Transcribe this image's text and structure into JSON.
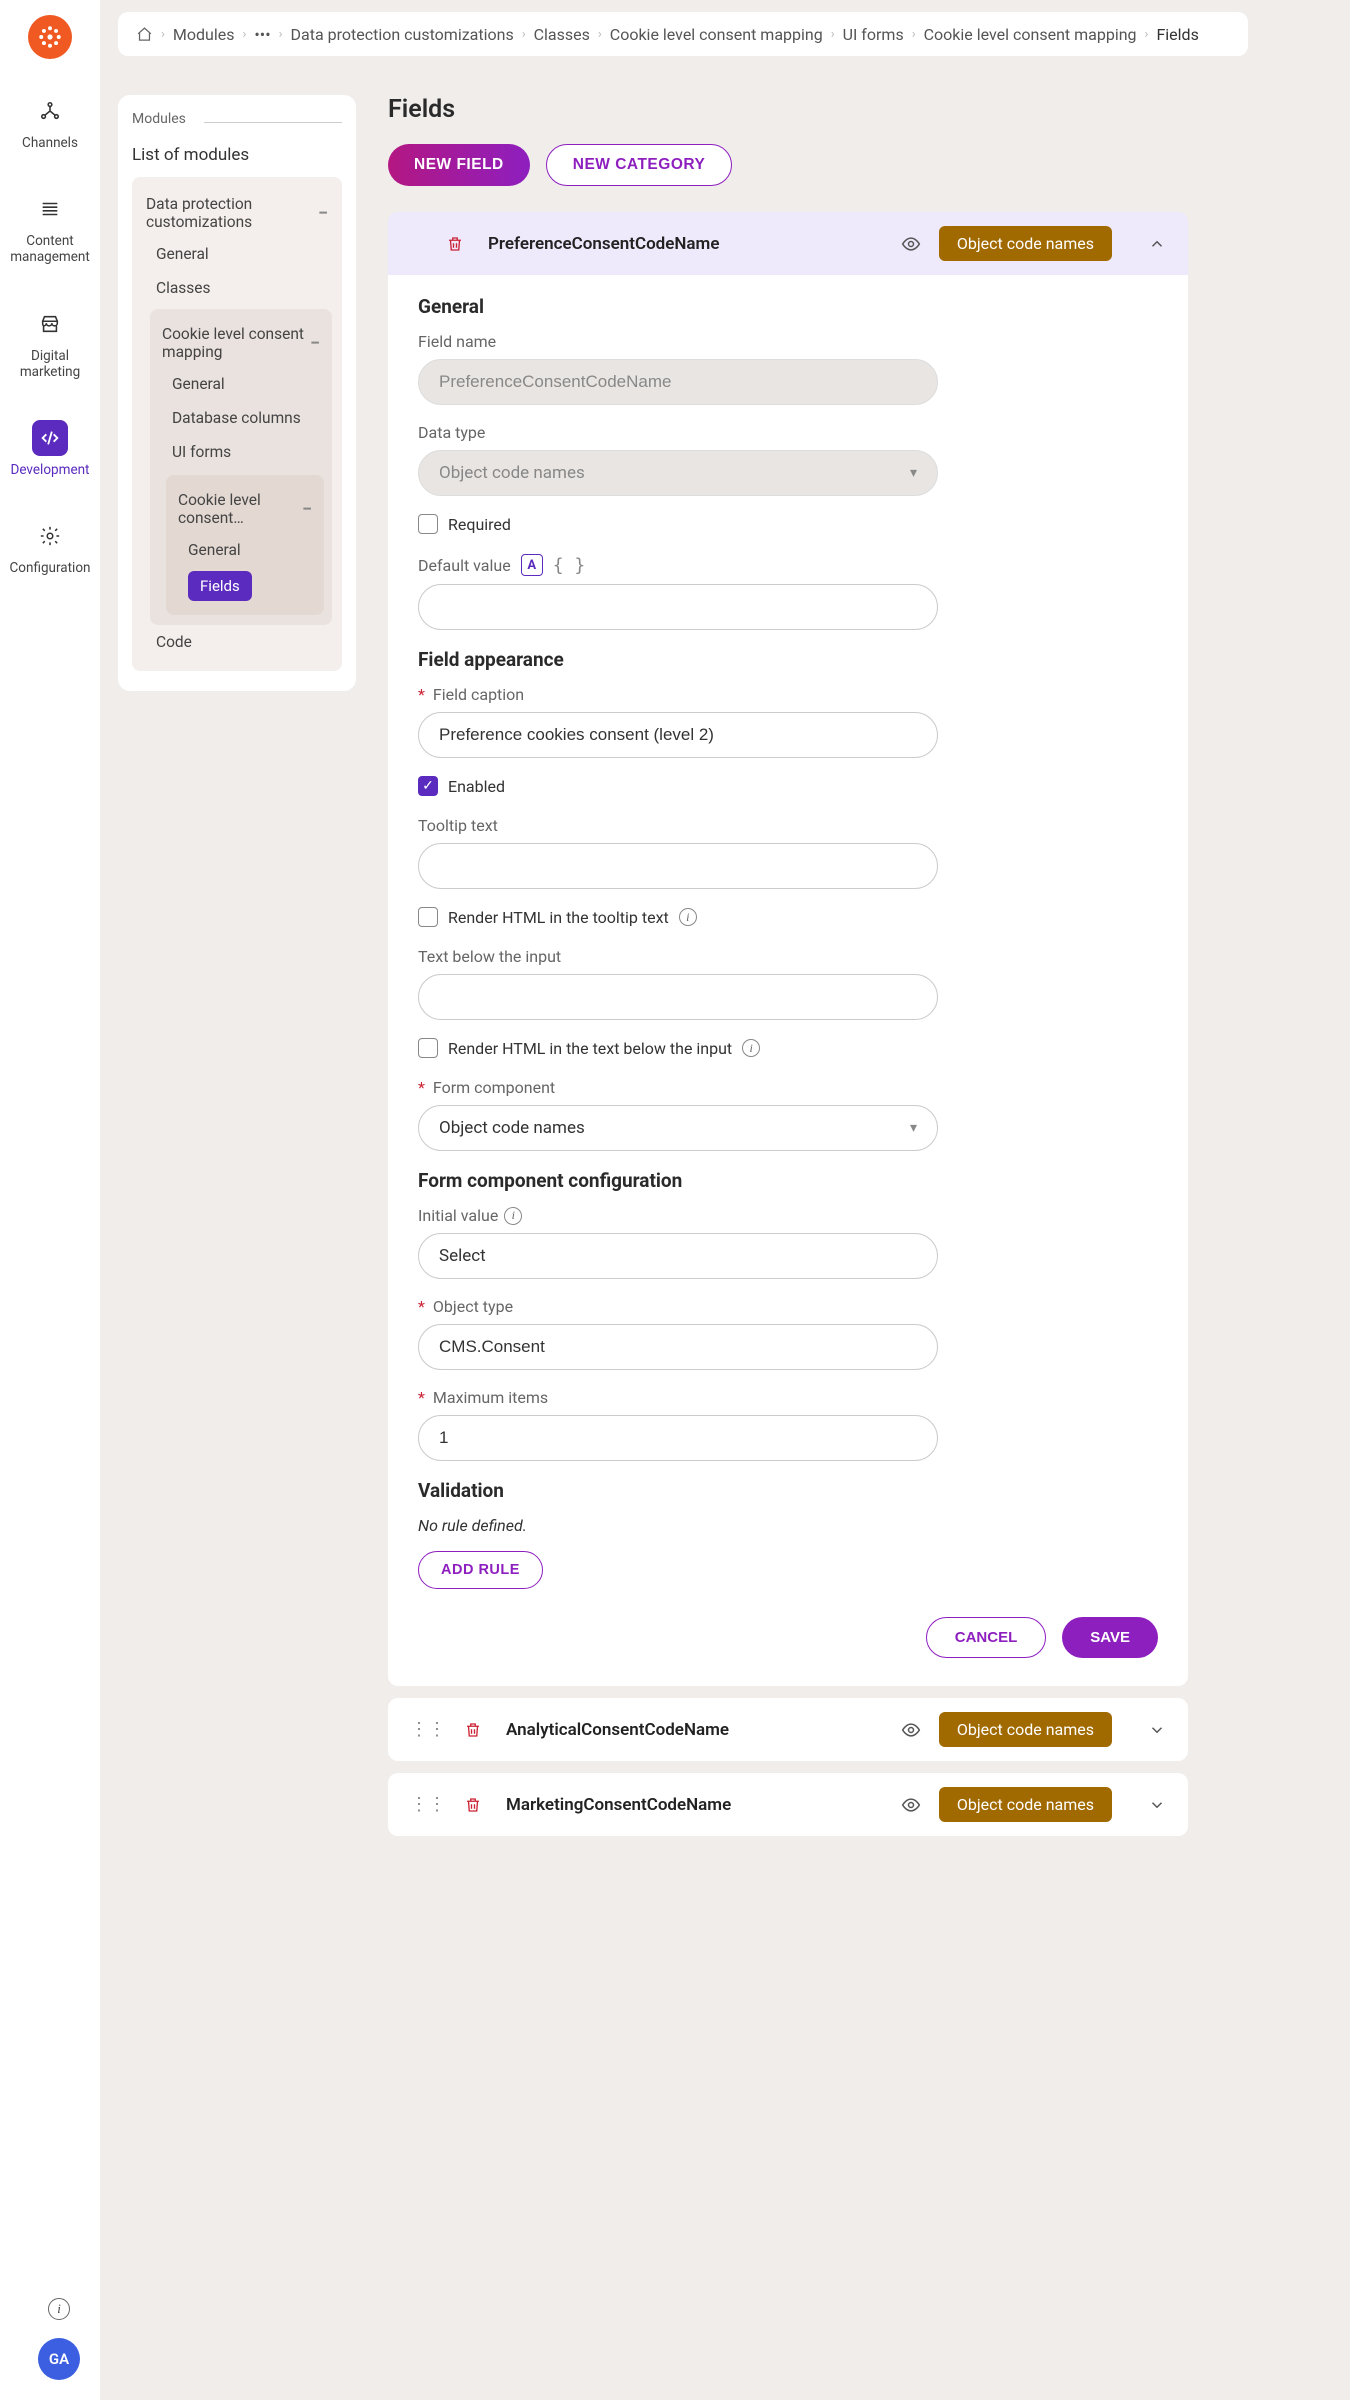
{
  "rail": {
    "items": [
      {
        "label": "Channels"
      },
      {
        "label": "Content management"
      },
      {
        "label": "Digital marketing"
      },
      {
        "label": "Development"
      },
      {
        "label": "Configuration"
      }
    ]
  },
  "breadcrumbs": [
    "Modules",
    "•••",
    "Data protection customizations",
    "Classes",
    "Cookie level consent mapping",
    "UI forms",
    "Cookie level consent mapping",
    "Fields"
  ],
  "midPanel": {
    "head": "Modules",
    "title": "List of modules",
    "root": "Data protection customizations",
    "items": {
      "general": "General",
      "classes": "Classes",
      "cookieMapping": "Cookie level consent mapping",
      "general2": "General",
      "dbCols": "Database columns",
      "uiForms": "UI forms",
      "cookieConsent": "Cookie level consent…",
      "general3": "General",
      "fields": "Fields",
      "code": "Code"
    }
  },
  "page": {
    "title": "Fields",
    "newField": "NEW FIELD",
    "newCategory": "NEW CATEGORY"
  },
  "badge": "Object code names",
  "expanded": {
    "name": "PreferenceConsentCodeName",
    "sections": {
      "general": "General",
      "appearance": "Field appearance",
      "formComp": "Form component configuration",
      "validation": "Validation"
    },
    "labels": {
      "fieldName": "Field name",
      "dataType": "Data type",
      "required": "Required",
      "defaultValue": "Default value",
      "fieldCaption": "Field caption",
      "enabled": "Enabled",
      "tooltip": "Tooltip text",
      "renderTooltip": "Render HTML in the tooltip text",
      "textBelow": "Text below the input",
      "renderBelow": "Render HTML in the text below the input",
      "formComponent": "Form component",
      "initialValue": "Initial value",
      "objectType": "Object type",
      "maxItems": "Maximum items",
      "noRule": "No rule defined.",
      "addRule": "ADD RULE",
      "cancel": "CANCEL",
      "save": "SAVE"
    },
    "values": {
      "fieldName": "PreferenceConsentCodeName",
      "dataType": "Object code names",
      "defaultValue": "",
      "fieldCaption": "Preference cookies consent (level 2)",
      "tooltip": "",
      "textBelow": "",
      "formComponent": "Object code names",
      "initialValue": "Select",
      "objectType": "CMS.Consent",
      "maxItems": "1"
    }
  },
  "collapsed": [
    {
      "name": "AnalyticalConsentCodeName"
    },
    {
      "name": "MarketingConsentCodeName"
    }
  ],
  "avatar": "GA"
}
